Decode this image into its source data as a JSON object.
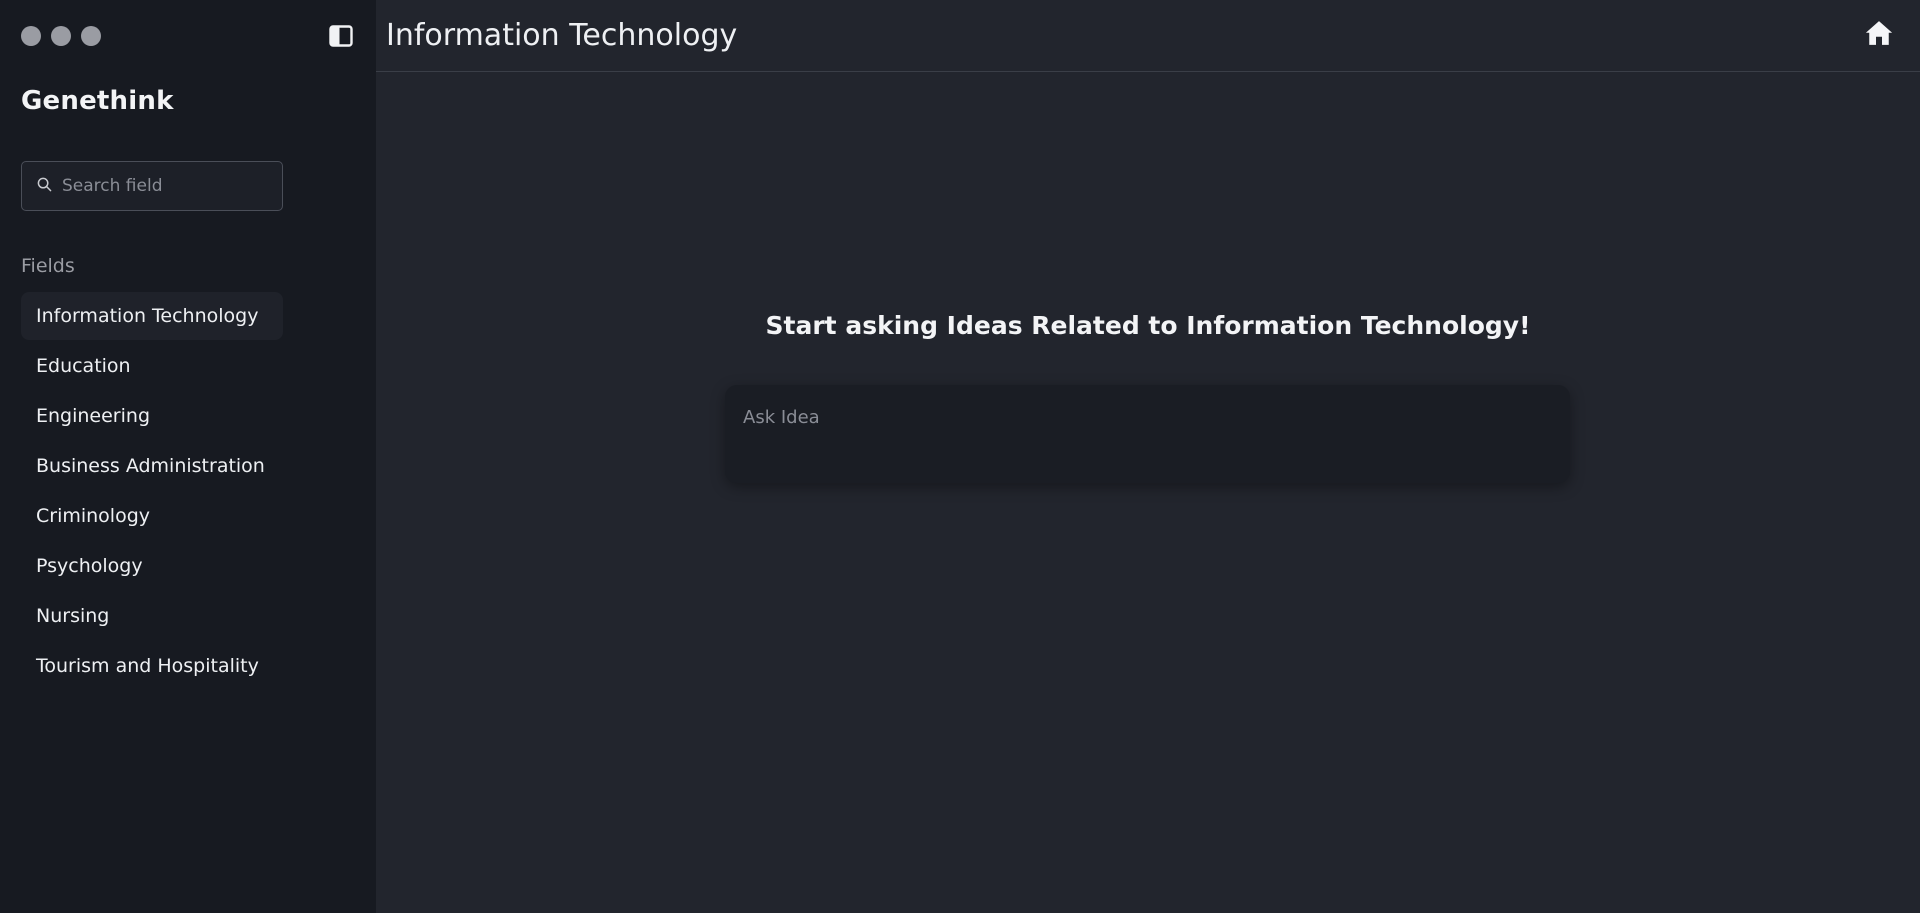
{
  "sidebar": {
    "brand": "Genethink",
    "search": {
      "placeholder": "Search field",
      "value": ""
    },
    "section_label": "Fields",
    "items": [
      {
        "label": "Information Technology",
        "active": true
      },
      {
        "label": "Education"
      },
      {
        "label": "Engineering"
      },
      {
        "label": "Business Administration"
      },
      {
        "label": "Criminology"
      },
      {
        "label": "Psychology"
      },
      {
        "label": "Nursing"
      },
      {
        "label": "Tourism and Hospitality"
      }
    ]
  },
  "header": {
    "title": "Information Technology"
  },
  "main": {
    "heading": "Start asking Ideas Related to Information Technology!",
    "ask": {
      "placeholder": "Ask Idea",
      "value": ""
    }
  },
  "icons": {
    "traffic_lights": "window-dots-icon",
    "sidebar_toggle": "sidebar-toggle-icon",
    "search": "search-icon",
    "home": "home-icon"
  },
  "colors": {
    "sidebar_bg": "#171a21",
    "main_bg": "#22252d",
    "input_bg": "#1a1d24",
    "text": "#eef0f3",
    "muted": "#9a9ca3"
  }
}
